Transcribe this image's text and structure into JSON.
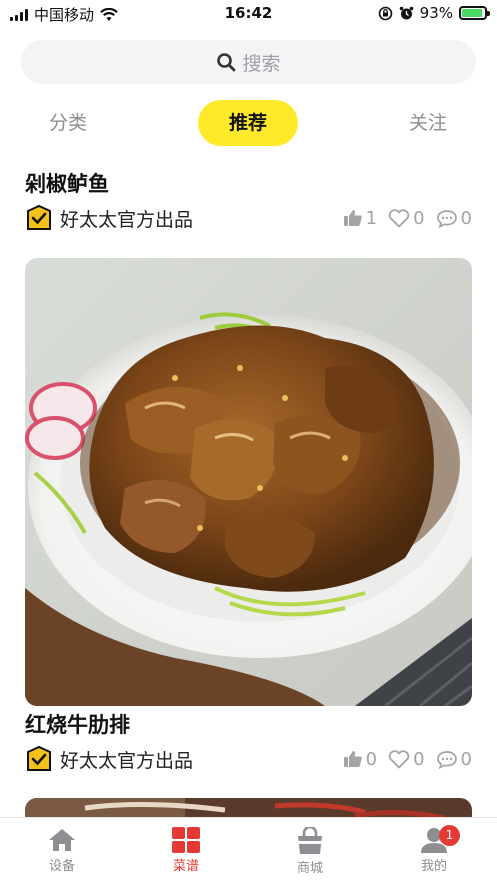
{
  "status_bar": {
    "carrier": "中国移动",
    "time": "16:42",
    "battery_percent": "93%",
    "battery_level": 0.93,
    "icons": [
      "signal-icon",
      "wifi-icon",
      "orientation-lock-icon",
      "alarm-icon",
      "battery-icon"
    ]
  },
  "search": {
    "placeholder": "搜索",
    "icon": "search-icon"
  },
  "tabs": [
    {
      "label": "分类",
      "active": false
    },
    {
      "label": "推荐",
      "active": true
    },
    {
      "label": "关注",
      "active": false
    }
  ],
  "colors": {
    "accent_yellow": "#ffe92b",
    "active_red": "#e53935",
    "muted_gray": "#8e8e93"
  },
  "recipes": [
    {
      "title": "剁椒鲈鱼",
      "author": "好太太官方出品",
      "likes": "1",
      "favorites": "0",
      "comments": "0"
    },
    {
      "title": "红烧牛肋排",
      "author": "好太太官方出品",
      "likes": "0",
      "favorites": "0",
      "comments": "0"
    }
  ],
  "bottom_nav": [
    {
      "label": "设备",
      "icon": "home-icon",
      "active": false
    },
    {
      "label": "菜谱",
      "icon": "grid-icon",
      "active": true
    },
    {
      "label": "商城",
      "icon": "shopping-bag-icon",
      "active": false
    },
    {
      "label": "我的",
      "icon": "user-icon",
      "active": false,
      "badge": "1"
    }
  ]
}
